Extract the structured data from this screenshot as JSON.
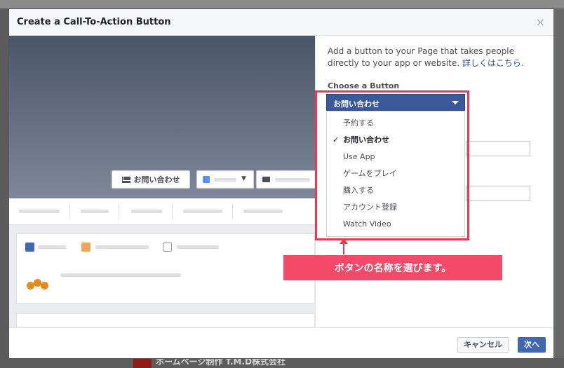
{
  "background": {
    "bottom_text": "ホームページ制作 T.M.D株式会社"
  },
  "dialog": {
    "title": "Create a Call-To-Action Button",
    "close_glyph": "×"
  },
  "preview": {
    "cta_button_label": "お問い合わせ"
  },
  "panel": {
    "description": "Add a button to your Page that takes people directly to your app or website. ",
    "learn_more_link": "詳しくはこちら.",
    "choose_label": "Choose a Button",
    "selected_value": "お問い合わせ",
    "options": [
      {
        "label": "予約する",
        "selected": false
      },
      {
        "label": "お問い合わせ",
        "selected": true
      },
      {
        "label": "Use App",
        "selected": false
      },
      {
        "label": "ゲームをプレイ",
        "selected": false
      },
      {
        "label": "購入する",
        "selected": false
      },
      {
        "label": "アカウント登録",
        "selected": false
      },
      {
        "label": "Watch Video",
        "selected": false
      }
    ]
  },
  "annotation": {
    "callout_text": "ボタンの名称を選びます。",
    "color": "#f24a67"
  },
  "footer": {
    "cancel_label": "キャンセル",
    "next_label": "次へ"
  },
  "colors": {
    "accent": "#3b5998",
    "primary_button": "#4267b2"
  }
}
